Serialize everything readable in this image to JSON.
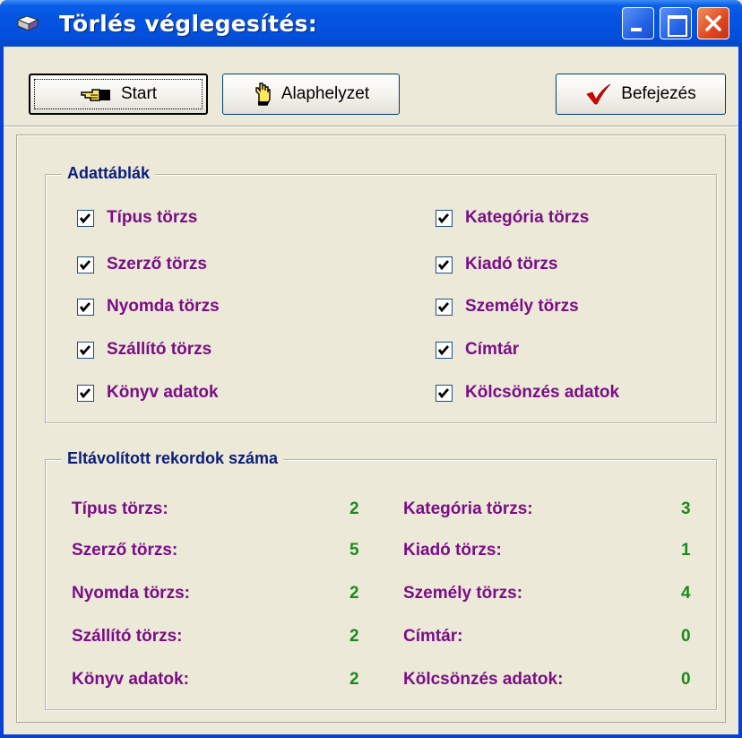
{
  "window": {
    "title": "Törlés véglegesítés:",
    "icon": "book-icon",
    "controls": [
      "minimize",
      "maximize",
      "close"
    ]
  },
  "toolbar": {
    "start_label": "Start",
    "reset_label": "Alaphelyzet",
    "finish_label": "Befejezés"
  },
  "tables_group": {
    "title": "Adattáblák",
    "left": [
      {
        "label": "Típus törzs",
        "checked": true
      },
      {
        "label": "Szerző törzs",
        "checked": true
      },
      {
        "label": "Nyomda törzs",
        "checked": true
      },
      {
        "label": "Szállító törzs",
        "checked": true
      },
      {
        "label": "Könyv adatok",
        "checked": true
      }
    ],
    "right": [
      {
        "label": "Kategória törzs",
        "checked": true
      },
      {
        "label": "Kiadó törzs",
        "checked": true
      },
      {
        "label": "Személy törzs",
        "checked": true
      },
      {
        "label": "Címtár",
        "checked": true
      },
      {
        "label": "Kölcsönzés adatok",
        "checked": true
      }
    ]
  },
  "removed_group": {
    "title": "Eltávolított rekordok száma",
    "left": [
      {
        "label": "Típus törzs:",
        "value": "2"
      },
      {
        "label": "Szerző törzs:",
        "value": "5"
      },
      {
        "label": "Nyomda törzs:",
        "value": "2"
      },
      {
        "label": "Szállító törzs:",
        "value": "2"
      },
      {
        "label": "Könyv adatok:",
        "value": "2"
      }
    ],
    "right": [
      {
        "label": "Kategória törzs:",
        "value": "3"
      },
      {
        "label": "Kiadó törzs:",
        "value": "1"
      },
      {
        "label": "Személy törzs:",
        "value": "4"
      },
      {
        "label": "Címtár:",
        "value": "0"
      },
      {
        "label": "Kölcsönzés adatok:",
        "value": "0"
      }
    ]
  },
  "colors": {
    "label": "#7B0E86",
    "count": "#1B8A1B",
    "group_title": "#0A1E7A",
    "titlebar": "#0453E0"
  }
}
